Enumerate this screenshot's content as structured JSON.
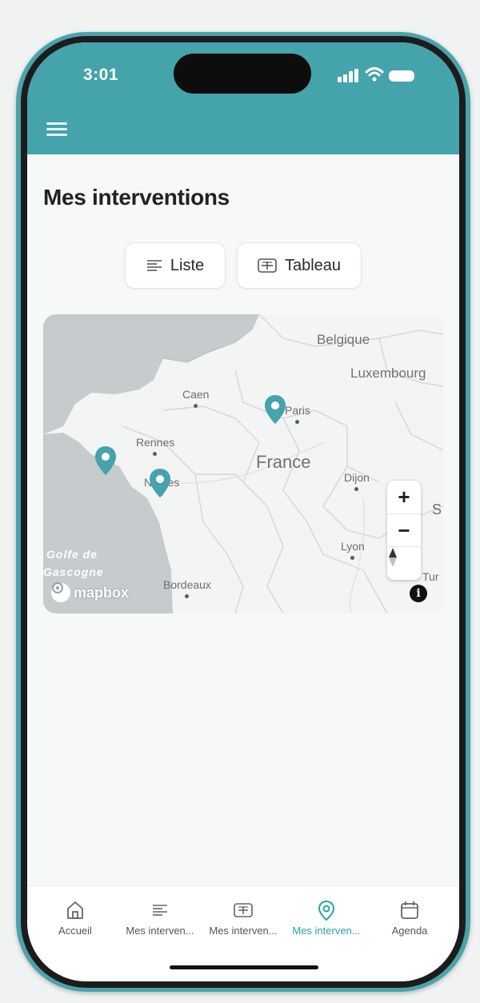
{
  "status_bar": {
    "time": "3:01",
    "signal_icon": "signal-icon",
    "wifi_icon": "wifi-icon",
    "battery_icon": "battery-icon"
  },
  "header": {
    "menu_icon": "hamburger-menu-icon"
  },
  "page": {
    "title": "Mes interventions"
  },
  "view_toggle": {
    "list_label": "Liste",
    "list_icon": "list-icon",
    "table_label": "Tableau",
    "table_icon": "table-icon"
  },
  "map": {
    "labels": {
      "belgique": "Belgique",
      "luxembourg": "Luxembourg",
      "caen": "Caen",
      "paris": "Paris",
      "rennes": "Rennes",
      "nantes": "Nantes",
      "france": "France",
      "dijon": "Dijon",
      "lyon": "Lyon",
      "bordeaux": "Bordeaux",
      "golfe_line1": "Golfe de",
      "golfe_line2": "Gascogne",
      "edge_s": "S",
      "edge_tur": "Tur"
    },
    "markers": [
      "Paris",
      "Brest",
      "Nantes"
    ],
    "zoom_in": "+",
    "zoom_out": "−",
    "attribution_logo": "mapbox",
    "accent_color": "#44a3ab"
  },
  "bottom_nav": {
    "items": [
      {
        "label": "Accueil",
        "icon": "home-icon"
      },
      {
        "label": "Mes interven...",
        "icon": "list-icon"
      },
      {
        "label": "Mes interven...",
        "icon": "table-icon"
      },
      {
        "label": "Mes interven...",
        "icon": "map-pin-icon",
        "active": true
      },
      {
        "label": "Agenda",
        "icon": "calendar-icon"
      }
    ]
  }
}
